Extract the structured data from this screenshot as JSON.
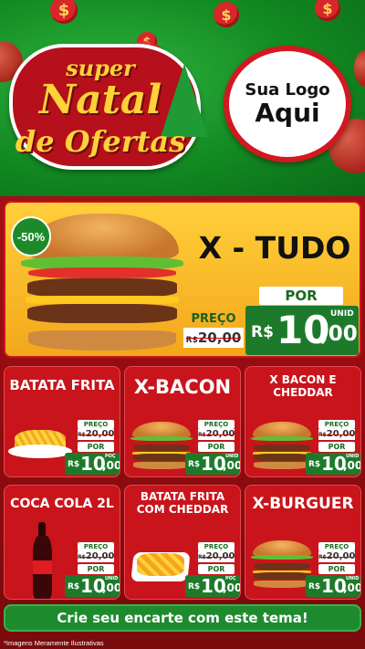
{
  "header": {
    "badge": {
      "word1": "super",
      "word2": "Natal",
      "word3": "de Ofertas"
    },
    "logo_placeholder": {
      "line1": "Sua Logo",
      "line2": "Aqui"
    },
    "coin_symbol": "$"
  },
  "hero": {
    "discount": "-50%",
    "title": "X - TUDO",
    "por_label": "POR",
    "preco_label": "PREÇO",
    "old_price_prefix": "R$",
    "old_price": "20,00",
    "currency": "R$",
    "price_int": "10",
    "price_cents": ",00",
    "unit": "UNID"
  },
  "products": [
    {
      "title": "BATATA FRITA",
      "image": "fries",
      "preco_label": "PREÇO",
      "old_prefix": "R$",
      "old_price": "20,00",
      "por_label": "POR",
      "currency": "R$",
      "price_int": "10",
      "price_cents": ",00",
      "unit": "POÇ"
    },
    {
      "title": "X-BACON",
      "image": "burger",
      "preco_label": "PREÇO",
      "old_prefix": "R$",
      "old_price": "20,00",
      "por_label": "POR",
      "currency": "R$",
      "price_int": "10",
      "price_cents": ",00",
      "unit": "UNID"
    },
    {
      "title": "X BACON E CHEDDAR",
      "image": "burger",
      "preco_label": "PREÇO",
      "old_prefix": "R$",
      "old_price": "20,00",
      "por_label": "POR",
      "currency": "R$",
      "price_int": "10",
      "price_cents": ",00",
      "unit": "UNID"
    },
    {
      "title": "COCA COLA 2L",
      "image": "bottle",
      "preco_label": "PREÇO",
      "old_prefix": "R$",
      "old_price": "20,00",
      "por_label": "POR",
      "currency": "R$",
      "price_int": "10",
      "price_cents": ",00",
      "unit": "UNID"
    },
    {
      "title": "BATATA FRITA COM CHEDDAR",
      "image": "cheddar-fries",
      "preco_label": "PREÇO",
      "old_prefix": "R$",
      "old_price": "20,00",
      "por_label": "POR",
      "currency": "R$",
      "price_int": "10",
      "price_cents": ",00",
      "unit": "POÇ"
    },
    {
      "title": "X-BURGUER",
      "image": "burger",
      "preco_label": "PREÇO",
      "old_prefix": "R$",
      "old_price": "20,00",
      "por_label": "POR",
      "currency": "R$",
      "price_int": "10",
      "price_cents": ",00",
      "unit": "UNID"
    }
  ],
  "cta": {
    "label": "Crie seu encarte com este tema!"
  },
  "disclaimer": "*Imagens Meramente Ilustrativas",
  "colors": {
    "green": "#1e7a2b",
    "red": "#c9141c",
    "yellow": "#ffcf3a",
    "dark_red": "#7d0a0a"
  }
}
